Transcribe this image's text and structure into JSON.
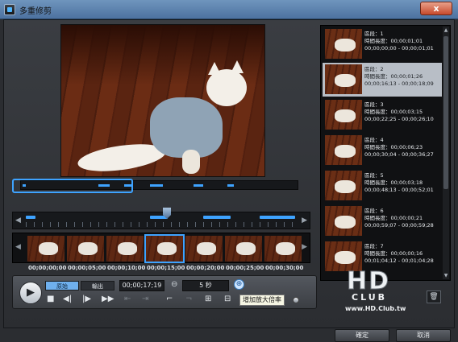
{
  "window": {
    "title": "多重修剪",
    "close_glyph": "x"
  },
  "preview": {
    "overview_segments": 6
  },
  "timeline": {
    "left_arrow": "◀",
    "right_arrow": "▶"
  },
  "filmstrip": {
    "left_arrow": "◀",
    "right_arrow": "▶",
    "timecodes": [
      "00;00;00;00",
      "00;00;05;00",
      "00;00;10;00",
      "00;00;15;00",
      "00;00;20;00",
      "00;00;25;00",
      "00;00;30;00"
    ],
    "selected_index": 3
  },
  "controls": {
    "tab_in": "原始",
    "tab_out": "輸出",
    "timecode": "00;00;17;19",
    "zoom_value": "5 秒",
    "tooltip": "增加放大倍率",
    "play_glyph": "▶",
    "stop_glyph": "■",
    "prev_frame_glyph": "◀|",
    "next_frame_glyph": "|▶",
    "fast_forward_glyph": "▶▶",
    "zoom_out_glyph": "⊖",
    "zoom_in_glyph": "⊕"
  },
  "clips": [
    {
      "num": "區段：1",
      "len": "時間長度：00;00;01;01",
      "range": "00;00;00;00 - 00;00;01;01"
    },
    {
      "num": "區段：2",
      "len": "時間長度：00;00;01;26",
      "range": "00;00;16;13 - 00;00;18;09"
    },
    {
      "num": "區段：3",
      "len": "時間長度：00;00;03;15",
      "range": "00;00;22;25 - 00;00;26;10"
    },
    {
      "num": "區段：4",
      "len": "時間長度：00;00;06;23",
      "range": "00;00;30;04 - 00;00;36;27"
    },
    {
      "num": "區段：5",
      "len": "時間長度：00;00;03;18",
      "range": "00;00;48;13 - 00;00;52;01"
    },
    {
      "num": "區段：6",
      "len": "時間長度：00;00;00;21",
      "range": "00;00;59;07 - 00;00;59;28"
    },
    {
      "num": "區段：7",
      "len": "時間長度：00;00;00;16",
      "range": "00;01;04;12 - 00;01;04;28"
    }
  ],
  "selected_clip": 2,
  "buttons": {
    "ok": "確定",
    "cancel": "取消",
    "trash_glyph": "🗑"
  },
  "watermark": {
    "logo": "HD",
    "club": "CLUB",
    "url": "www.HD.Club.tw"
  },
  "colors": {
    "accent": "#3ea3ff",
    "titlebar": "#5d82ae",
    "background": "#2b2d31"
  }
}
